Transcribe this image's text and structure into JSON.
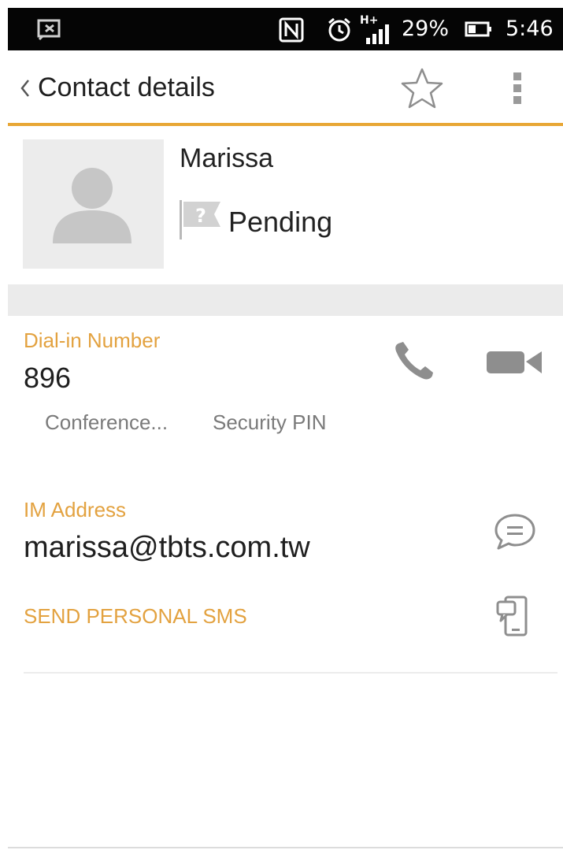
{
  "status_bar": {
    "battery_percent": "29%",
    "time": "5:46",
    "network_type": "H+",
    "icons": [
      "notification-app-icon",
      "nfc-icon",
      "alarm-icon",
      "signal-icon",
      "battery-icon"
    ]
  },
  "action_bar": {
    "title": "Contact details",
    "back_icon": "chevron-left-icon",
    "favorite_icon": "star-outline-icon",
    "overflow_icon": "more-vertical-icon"
  },
  "contact": {
    "name": "Marissa",
    "presence_status": "Pending",
    "presence_icon": "unknown-status-flag-icon",
    "avatar_icon": "default-person-icon"
  },
  "dial_in": {
    "label": "Dial-in Number",
    "number": "896",
    "conference_label": "Conference...",
    "security_pin_label": "Security PIN",
    "call_icon": "phone-icon",
    "video_icon": "video-camera-icon"
  },
  "im": {
    "label": "IM Address",
    "address": "marissa@tbts.com.tw",
    "chat_icon": "chat-bubble-icon"
  },
  "sms": {
    "label": "SEND PERSONAL SMS",
    "sms_icon": "mobile-message-icon"
  },
  "colors": {
    "accent": "#e8a736",
    "label_orange": "#e3a240",
    "icon_gray": "#8e8e8e",
    "status_bar": "#050505"
  }
}
